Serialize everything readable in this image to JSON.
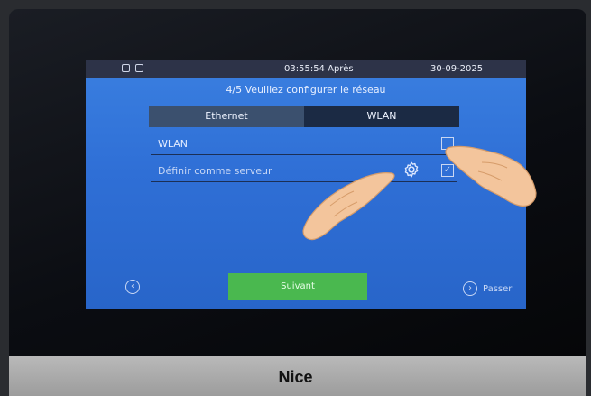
{
  "device": {
    "brand": "Nice"
  },
  "statusbar": {
    "time": "03:55:54",
    "period": "Après",
    "date": "30-09-2025"
  },
  "page": {
    "title": "4/5 Veuillez configurer le réseau"
  },
  "tabs": [
    {
      "label": "Ethernet",
      "selected": false
    },
    {
      "label": "WLAN",
      "selected": true
    }
  ],
  "settings": {
    "wlan": {
      "label": "WLAN",
      "checked": false
    },
    "server": {
      "label": "Définir comme serveur",
      "checked": true
    }
  },
  "footer": {
    "next_label": "Suivant",
    "skip_label": "Passer"
  },
  "icons": {
    "status": [
      "lock-icon",
      "shield-icon"
    ],
    "settings": "gear-icon",
    "back": "chevron-left-icon",
    "skip": "chevron-right-icon"
  },
  "colors": {
    "screen_bg": "#2f6fd6",
    "next_button": "#4ab84f",
    "tab_selected": "#1b2a44"
  }
}
